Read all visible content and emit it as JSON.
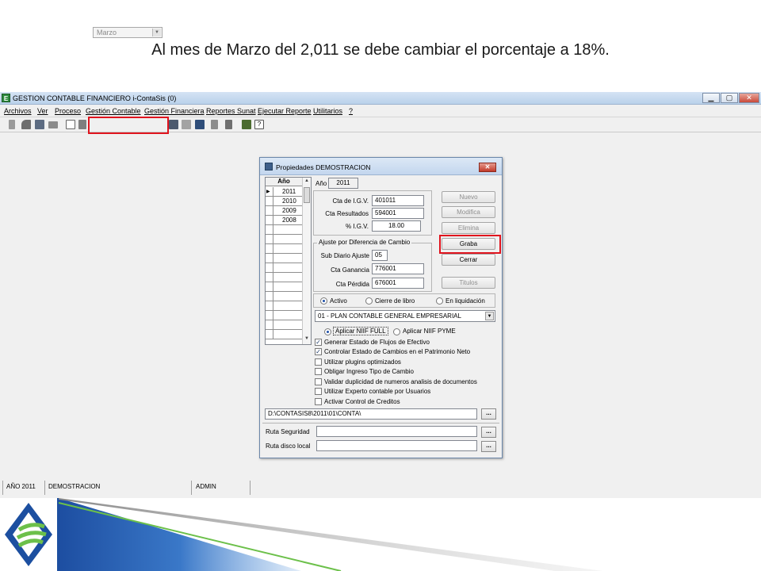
{
  "slide": {
    "title": "Al mes de Marzo del 2,011 se debe cambiar el porcentaje a 18%."
  },
  "app": {
    "icon_letter": "E",
    "title": "GESTION CONTABLE FINANCIERO i-ContaSis (0)",
    "window_buttons": {
      "minimize": "▁",
      "maximize": "▢",
      "close": "✕"
    },
    "menu": [
      "Archivos",
      "Ver",
      "Proceso",
      "Gestión Contable",
      "Gestión Financiera",
      "Reportes Sunat",
      "Ejecutar Reporte",
      "Utilitarios",
      "?"
    ],
    "toolbar": {
      "month": "Marzo"
    },
    "status": {
      "year": "AÑO 2011",
      "company": "DEMOSTRACION",
      "user": "ADMIN"
    }
  },
  "dialog": {
    "title": "Propiedades DEMOSTRACION",
    "close": "✕",
    "year_grid": {
      "header": "Año",
      "years": [
        "2011",
        "2010",
        "2009",
        "2008"
      ]
    },
    "anio": {
      "label": "Año",
      "value": "2011"
    },
    "igv": {
      "cta_igv_label": "Cta de I.G.V.",
      "cta_igv": "401011",
      "cta_resultados_label": "Cta Resultados",
      "cta_resultados": "594001",
      "pct_igv_label": "% I.G.V.",
      "pct_igv": "18.00"
    },
    "ajuste": {
      "title": "Ajuste por Diferencia de Cambio",
      "sub_diario_label": "Sub Diario Ajuste",
      "sub_diario": "05",
      "cta_ganancia_label": "Cta Ganancia",
      "cta_ganancia": "776001",
      "cta_perdida_label": "Cta Pérdida",
      "cta_perdida": "676001"
    },
    "buttons": {
      "nuevo": "Nuevo",
      "modifica": "Modifica",
      "elimina": "Elimina",
      "graba": "Graba",
      "cerrar": "Cerrar",
      "titulos": "Titulos"
    },
    "estado": {
      "activo": "Activo",
      "cierre": "Cierre de libro",
      "liquidacion": "En liquidación",
      "selected": "activo"
    },
    "plan": "01 - PLAN CONTABLE GENERAL EMPRESARIAL",
    "niif": {
      "full": "Aplicar NIIF FULL",
      "pyme": "Aplicar NIIF PYME"
    },
    "options": [
      {
        "label": "Generar Estado de Flujos de Efectivo",
        "checked": true
      },
      {
        "label": "Controlar Estado de Cambios en el Patrimonio Neto",
        "checked": true
      },
      {
        "label": "Utilizar plugins optimizados",
        "checked": false
      },
      {
        "label": "Obligar Ingreso Tipo de Cambio",
        "checked": false
      },
      {
        "label": "Validar duplicidad de numeros analisis de documentos",
        "checked": false
      },
      {
        "label": "Utilizar Experto contable por Usuarios",
        "checked": false
      },
      {
        "label": "Activar Control de Creditos",
        "checked": false
      }
    ],
    "path": "D:\\CONTASIS8\\2011\\01\\CONTA\\",
    "ruta_seguridad_label": "Ruta Seguridad",
    "ruta_local_label": "Ruta disco local",
    "browse": "..."
  },
  "colors": {
    "highlight": "#e0141e",
    "accent": "#1c4fa0"
  }
}
